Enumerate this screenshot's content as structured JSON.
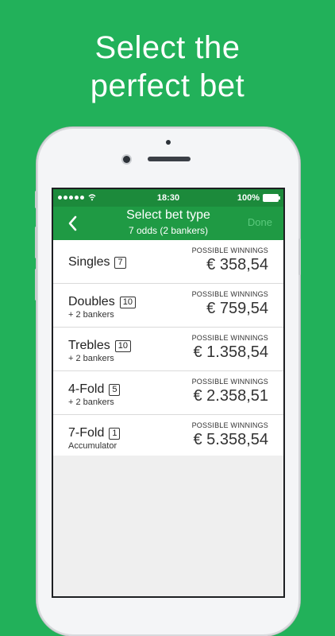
{
  "headline": {
    "line1": "Select the",
    "line2": "perfect bet"
  },
  "colors": {
    "background": "#22b15a",
    "status_bar": "#1c8a3b",
    "nav_bar": "#1f9a44",
    "done_disabled": "#5bc97d"
  },
  "status_bar": {
    "time": "18:30",
    "battery": "100%",
    "signal_icon": "signal-dots-icon",
    "wifi_icon": "wifi-icon",
    "battery_icon": "battery-icon"
  },
  "nav": {
    "back_icon": "chevron-left-icon",
    "title": "Select bet type",
    "subtitle": "7 odds (2 bankers)",
    "done_label": "Done"
  },
  "bet_types": [
    {
      "name": "Singles",
      "count": "7",
      "sub": "",
      "label": "POSSIBLE WINNINGS",
      "value": "€ 358,54"
    },
    {
      "name": "Doubles",
      "count": "10",
      "sub": "+ 2 bankers",
      "label": "POSSIBLE WINNINGS",
      "value": "€ 759,54"
    },
    {
      "name": "Trebles",
      "count": "10",
      "sub": "+ 2 bankers",
      "label": "POSSIBLE WINNINGS",
      "value": "€ 1.358,54"
    },
    {
      "name": "4-Fold",
      "count": "5",
      "sub": "+ 2 bankers",
      "label": "POSSIBLE WINNINGS",
      "value": "€ 2.358,51"
    },
    {
      "name": "7-Fold",
      "count": "1",
      "sub": "Accumulator",
      "label": "POSSIBLE WINNINGS",
      "value": "€ 5.358,54"
    }
  ]
}
